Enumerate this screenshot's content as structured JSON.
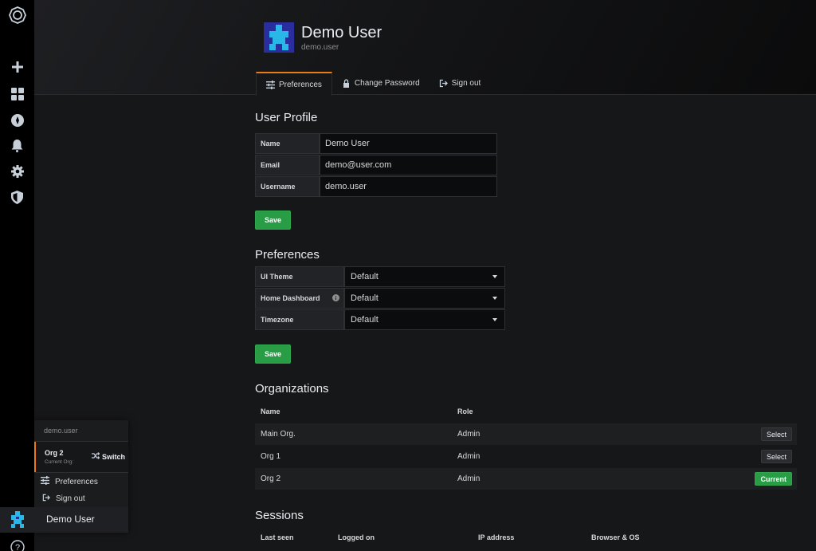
{
  "user": {
    "display_name": "Demo User",
    "login": "demo.user"
  },
  "tabs": [
    {
      "label": "Preferences",
      "icon": "sliders-icon",
      "active": true
    },
    {
      "label": "Change Password",
      "icon": "lock-icon",
      "active": false
    },
    {
      "label": "Sign out",
      "icon": "sign-out-icon",
      "active": false
    }
  ],
  "sidebar": {
    "items": [
      {
        "name": "grafana-logo",
        "icon": "logo-icon"
      },
      {
        "name": "create",
        "icon": "plus-icon"
      },
      {
        "name": "dashboards",
        "icon": "apps-icon"
      },
      {
        "name": "explore",
        "icon": "compass-icon"
      },
      {
        "name": "alerting",
        "icon": "bell-icon"
      },
      {
        "name": "configuration",
        "icon": "gear-icon"
      },
      {
        "name": "server-admin",
        "icon": "shield-icon"
      },
      {
        "name": "help",
        "icon": "question-icon"
      }
    ]
  },
  "profile": {
    "title": "User Profile",
    "fields": [
      {
        "label": "Name",
        "value": "Demo User"
      },
      {
        "label": "Email",
        "value": "demo@user.com"
      },
      {
        "label": "Username",
        "value": "demo.user"
      }
    ],
    "save_label": "Save"
  },
  "preferences": {
    "title": "Preferences",
    "fields": [
      {
        "label": "UI Theme",
        "value": "Default"
      },
      {
        "label": "Home Dashboard",
        "value": "Default",
        "has_info": true
      },
      {
        "label": "Timezone",
        "value": "Default"
      }
    ],
    "save_label": "Save"
  },
  "organizations": {
    "title": "Organizations",
    "columns": [
      "Name",
      "Role"
    ],
    "rows": [
      {
        "name": "Main Org.",
        "role": "Admin",
        "action": "Select"
      },
      {
        "name": "Org 1",
        "role": "Admin",
        "action": "Select"
      },
      {
        "name": "Org 2",
        "role": "Admin",
        "action": "Current"
      }
    ]
  },
  "sessions": {
    "title": "Sessions",
    "columns": [
      "Last seen",
      "Logged on",
      "IP address",
      "Browser & OS"
    ]
  },
  "popup": {
    "login": "demo.user",
    "current_org": "Org 2",
    "current_org_sub": "Current Org:",
    "switch_label": "Switch",
    "items": [
      {
        "label": "Preferences",
        "icon": "sliders-icon"
      },
      {
        "label": "Sign out",
        "icon": "sign-out-icon"
      }
    ],
    "user_label": "Demo User"
  },
  "colors": {
    "accent": "#eb7b18",
    "success": "#299c46",
    "background": "#161719",
    "sidebar": "#000000"
  }
}
